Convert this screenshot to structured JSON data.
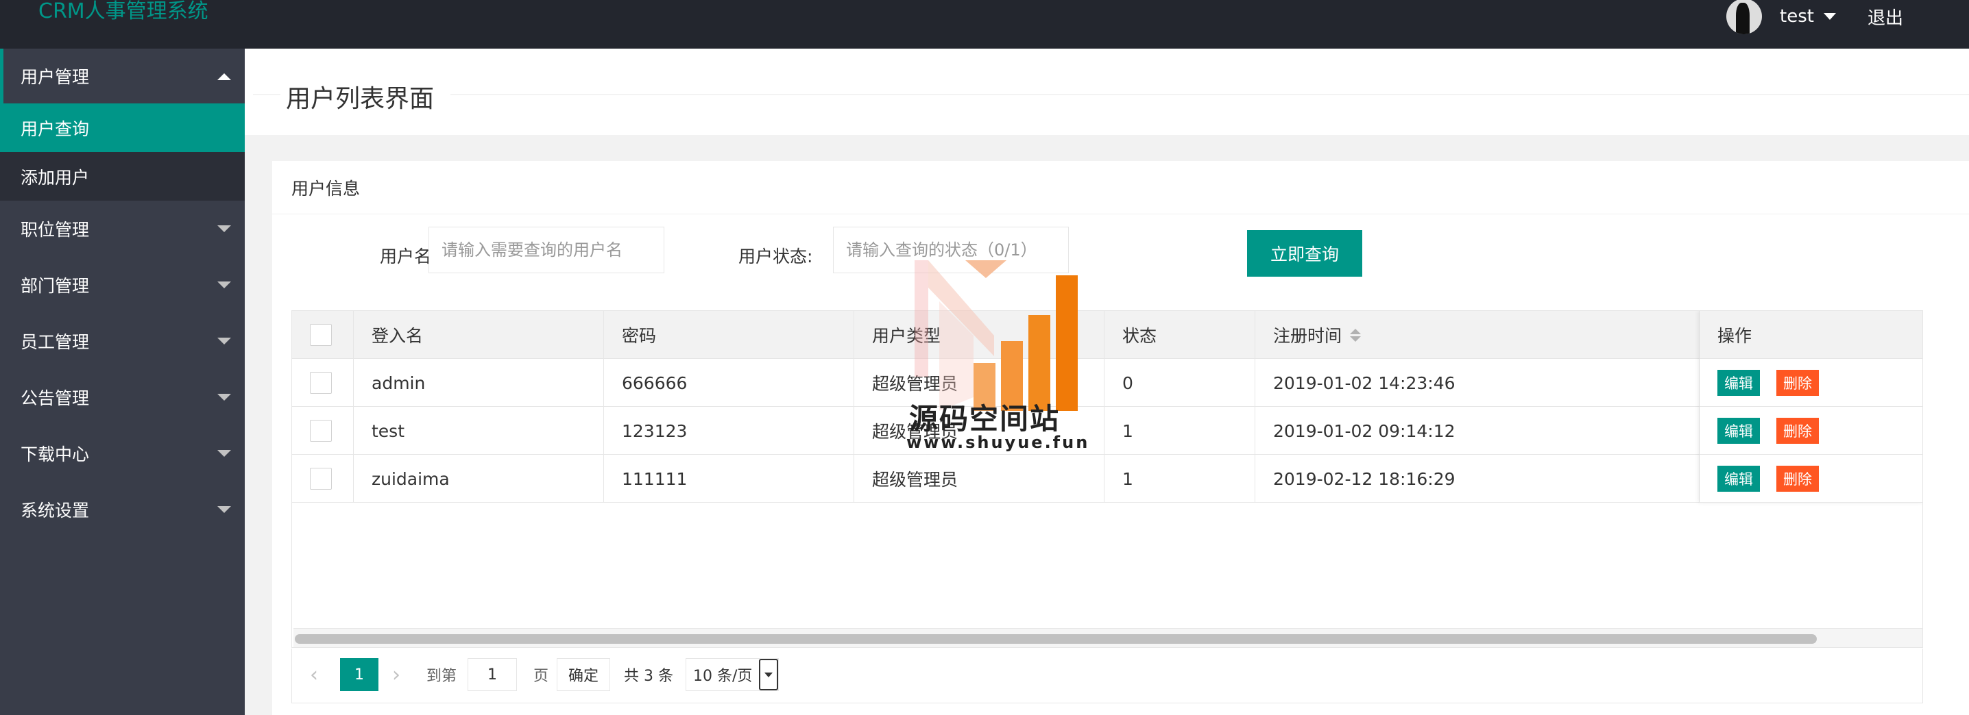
{
  "app": {
    "title": "CRM人事管理系统"
  },
  "user": {
    "name": "test",
    "logout_label": "退出"
  },
  "sidebar": {
    "items": [
      {
        "label": "用户管理",
        "expanded": true,
        "children": [
          {
            "label": "用户查询",
            "active": true
          },
          {
            "label": "添加用户",
            "active": false
          }
        ]
      },
      {
        "label": "职位管理",
        "expanded": false
      },
      {
        "label": "部门管理",
        "expanded": false
      },
      {
        "label": "员工管理",
        "expanded": false
      },
      {
        "label": "公告管理",
        "expanded": false
      },
      {
        "label": "下载中心",
        "expanded": false
      },
      {
        "label": "系统设置",
        "expanded": false
      }
    ]
  },
  "page": {
    "title": "用户列表界面"
  },
  "card": {
    "title": "用户信息"
  },
  "search": {
    "username_label": "用户名:",
    "username_placeholder": "请输入需要查询的用户名",
    "status_label": "用户状态:",
    "status_placeholder": "请输入查询的状态（0/1）",
    "submit_label": "立即查询"
  },
  "table": {
    "columns": [
      "登入名",
      "密码",
      "用户类型",
      "状态",
      "注册时间",
      "操作"
    ],
    "rows": [
      {
        "login": "admin",
        "password": "666666",
        "type": "超级管理员",
        "status": "0",
        "registered": "2019-01-02 14:23:46"
      },
      {
        "login": "test",
        "password": "123123",
        "type": "超级管理员",
        "status": "1",
        "registered": "2019-01-02 09:14:12"
      },
      {
        "login": "zuidaima",
        "password": "111111",
        "type": "超级管理员",
        "status": "1",
        "registered": "2019-02-12 18:16:29"
      }
    ],
    "edit_label": "编辑",
    "delete_label": "删除"
  },
  "pager": {
    "current_page": "1",
    "goto_label": "到第",
    "goto_value": "1",
    "page_unit": "页",
    "confirm_label": "确定",
    "total_label": "共 3 条",
    "page_size": "10 条/页"
  },
  "watermark": {
    "text": "源码空间站",
    "url": "www.shuyue.fun"
  },
  "colors": {
    "accent": "#009688",
    "danger": "#ff5722",
    "header_bg": "#23262e",
    "sidebar_bg": "#393d49"
  }
}
